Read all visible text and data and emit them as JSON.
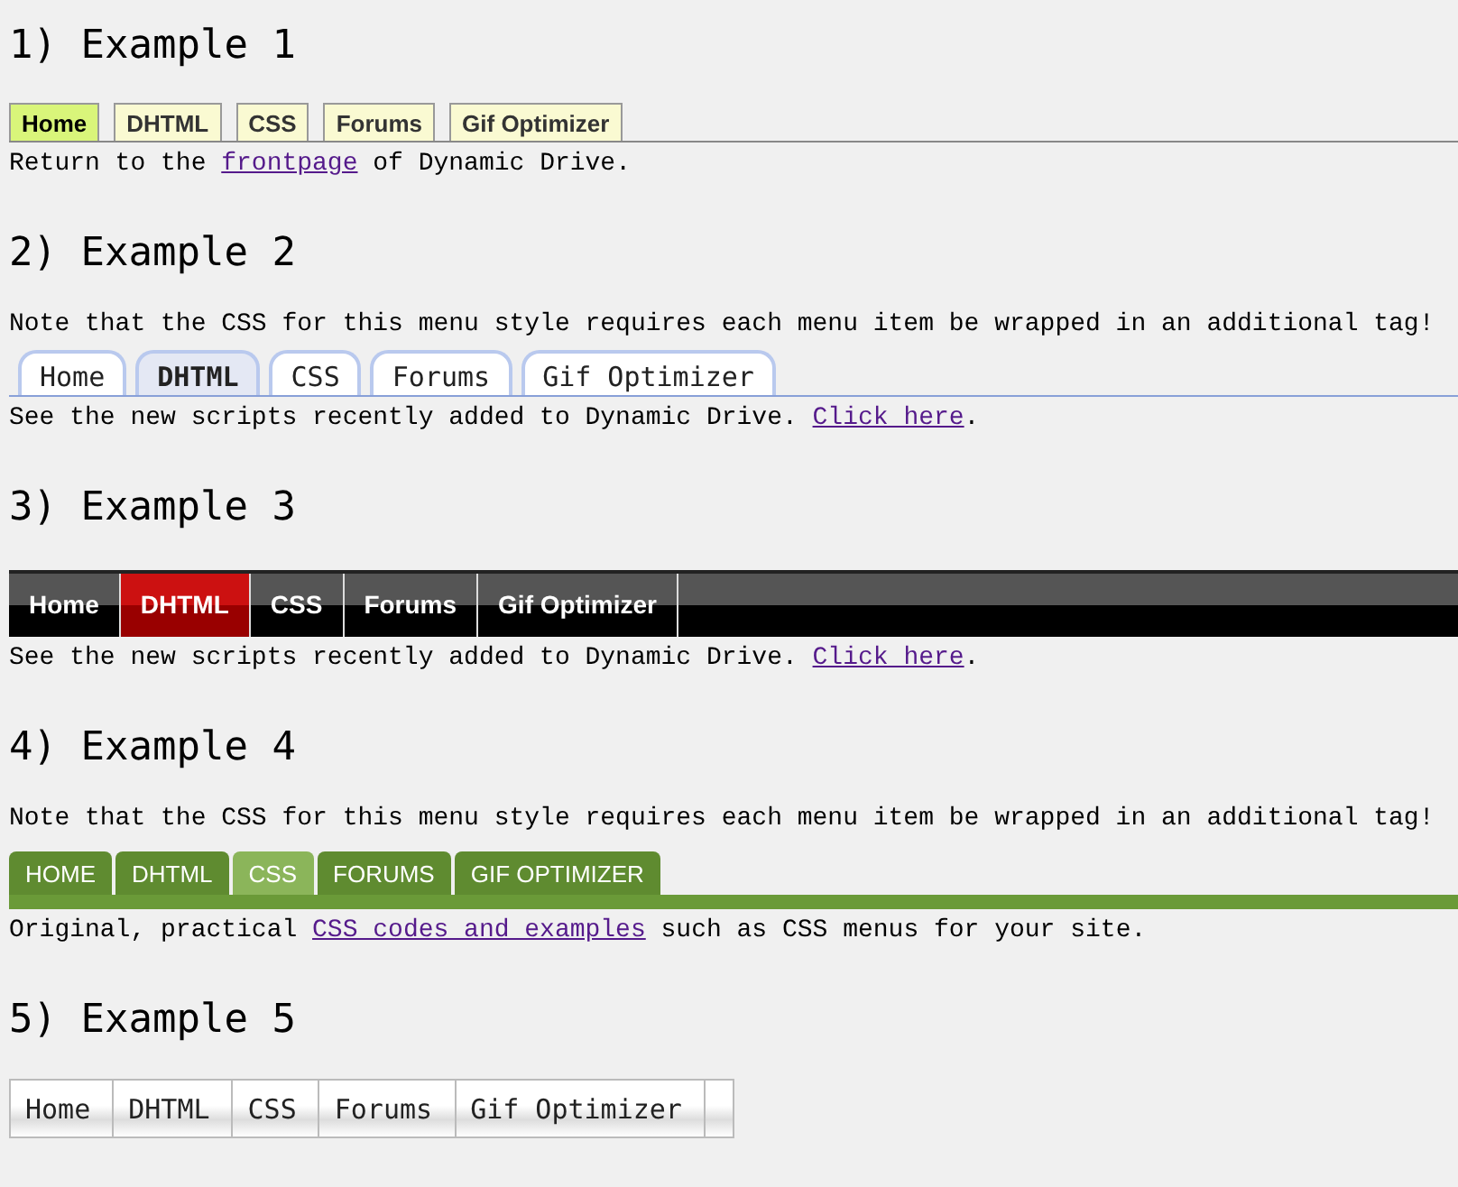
{
  "sections": [
    {
      "heading": "1) Example 1",
      "menu": {
        "kind": "boxed",
        "items": [
          {
            "label": "Home",
            "selected": true
          },
          {
            "label": "DHTML",
            "selected": false
          },
          {
            "label": "CSS",
            "selected": false
          },
          {
            "label": "Forums",
            "selected": false
          },
          {
            "label": "Gif Optimizer",
            "selected": false
          }
        ]
      },
      "caption": {
        "before": "Return to the ",
        "link": "frontpage",
        "after": " of Dynamic Drive."
      }
    },
    {
      "heading": "2) Example 2",
      "note": "Note that the CSS for this menu style requires each menu item be wrapped in an additional tag!",
      "menu": {
        "kind": "rounded",
        "items": [
          {
            "label": "Home",
            "selected": false
          },
          {
            "label": "DHTML",
            "selected": true
          },
          {
            "label": "CSS",
            "selected": false
          },
          {
            "label": "Forums",
            "selected": false
          },
          {
            "label": "Gif Optimizer",
            "selected": false
          }
        ]
      },
      "caption": {
        "before": "See the new scripts recently added to Dynamic Drive. ",
        "link": "Click here",
        "after": "."
      }
    },
    {
      "heading": "3) Example 3",
      "menu": {
        "kind": "dark",
        "items": [
          {
            "label": "Home",
            "selected": false
          },
          {
            "label": "DHTML",
            "selected": true
          },
          {
            "label": "CSS",
            "selected": false
          },
          {
            "label": "Forums",
            "selected": false
          },
          {
            "label": "Gif Optimizer",
            "selected": false
          }
        ]
      },
      "caption": {
        "before": "See the new scripts recently added to Dynamic Drive. ",
        "link": "Click here",
        "after": "."
      }
    },
    {
      "heading": "4) Example 4",
      "note": "Note that the CSS for this menu style requires each menu item be wrapped in an additional tag!",
      "menu": {
        "kind": "green",
        "items": [
          {
            "label": "HOME",
            "selected": false
          },
          {
            "label": "DHTML",
            "selected": false
          },
          {
            "label": "CSS",
            "selected": true
          },
          {
            "label": "FORUMS",
            "selected": false
          },
          {
            "label": "GIF OPTIMIZER",
            "selected": false
          }
        ]
      },
      "caption": {
        "before": "Original, practical ",
        "link": "CSS codes and examples",
        "after": " such as CSS menus for your site."
      }
    },
    {
      "heading": "5) Example 5",
      "menu": {
        "kind": "plain",
        "items": [
          {
            "label": "Home",
            "selected": false
          },
          {
            "label": "DHTML",
            "selected": false
          },
          {
            "label": "CSS",
            "selected": false
          },
          {
            "label": "Forums",
            "selected": false
          },
          {
            "label": "Gif Optimizer",
            "selected": false
          }
        ]
      }
    }
  ]
}
